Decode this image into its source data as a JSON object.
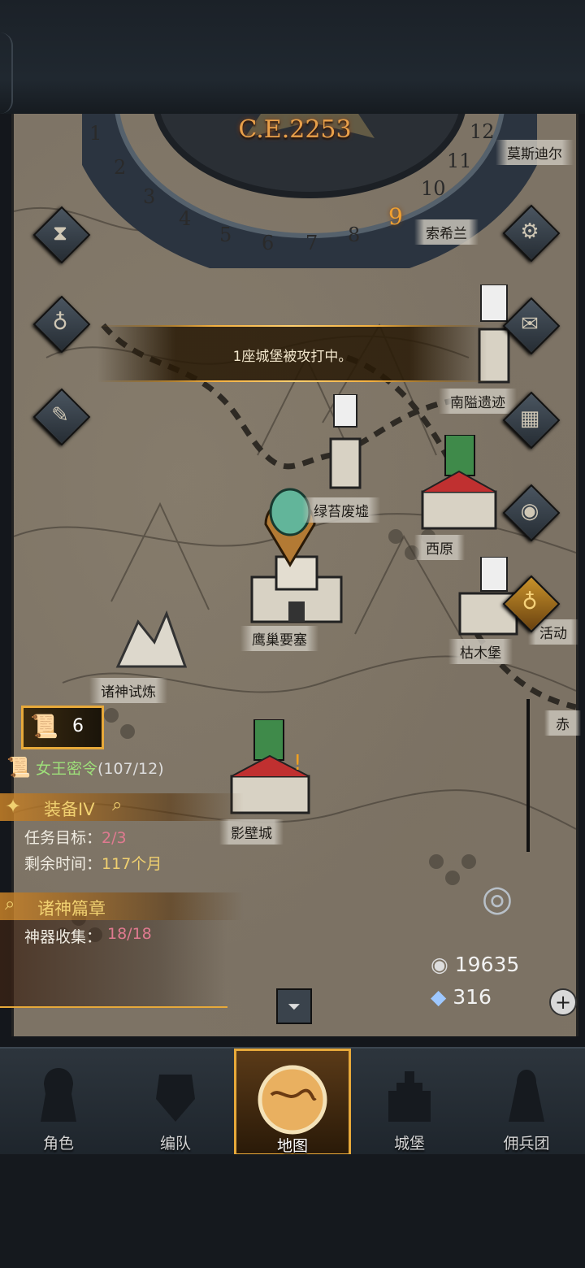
{
  "era": {
    "year": "C.E.2253",
    "months": [
      "1",
      "2",
      "3",
      "4",
      "5",
      "6",
      "7",
      "8",
      "9",
      "10",
      "11",
      "12"
    ],
    "active_month": "9"
  },
  "alert": {
    "message": "1座城堡被攻打中。"
  },
  "locations": {
    "moss": "莫斯迪尔",
    "sohilan": "索希兰",
    "nanai": "南隘遗迹",
    "lvtai": "绿苔废墟",
    "xiyuan": "西原",
    "yingchao": "鹰巢要塞",
    "kumu": "枯木堡",
    "huodong": "活动",
    "zhushen": "诸神试炼",
    "chi": "赤",
    "yingbi": "影壁城"
  },
  "scroll_counter": "6",
  "quests": {
    "queen": {
      "title": "女王密令",
      "progress": "(107/12)"
    },
    "equip": {
      "title": "装备IV",
      "target_label": "任务目标：",
      "target_value": "2/3",
      "time_label": "剩余时间：",
      "time_value": "117个月"
    },
    "gods": {
      "title": "诸神篇章",
      "collect_label": "神器收集：",
      "collect_value": "18/18"
    }
  },
  "resources": {
    "silver": "19635",
    "crystal": "316"
  },
  "nav": [
    {
      "label": "角色"
    },
    {
      "label": "编队"
    },
    {
      "label": "地图"
    },
    {
      "label": "城堡"
    },
    {
      "label": "佣兵团"
    }
  ],
  "colors": {
    "accent": "#e7a93a",
    "pink": "#e07a90",
    "green": "#9ee07a",
    "map": "#7d7365"
  }
}
